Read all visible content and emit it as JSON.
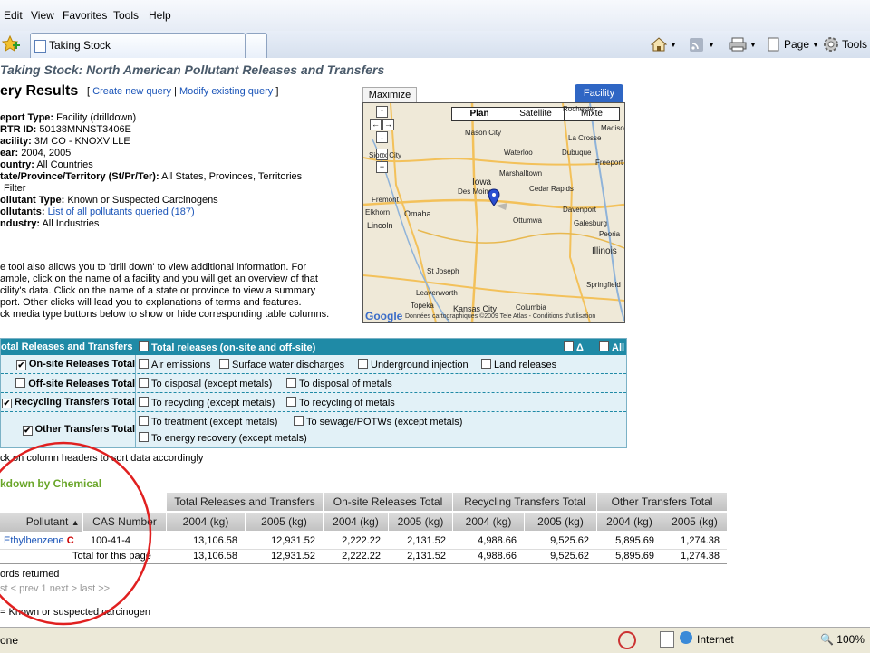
{
  "menu": [
    "Edit",
    "View",
    "Favorites",
    "Tools",
    "Help"
  ],
  "tab": {
    "label": "Taking Stock"
  },
  "toolbar": {
    "page": "Page",
    "tools": "Tools"
  },
  "page": {
    "title": "Taking Stock: North American Pollutant Releases and Transfers",
    "query_heading": "ery Results",
    "links": {
      "create": "Create new query",
      "modify": "Modify existing query"
    },
    "props": [
      {
        "label": "eport Type:",
        "value": "Facility (drilldown)"
      },
      {
        "label": "RTR ID:",
        "value": "50138MNNST3406E"
      },
      {
        "label": "acility:",
        "value": "3M CO - KNOXVILLE"
      },
      {
        "label": "ear:",
        "value": "2004, 2005"
      },
      {
        "label": "ountry:",
        "value": "All Countries"
      },
      {
        "label": "tate/Province/Territory (St/Pr/Ter):",
        "value": "All States, Provinces, Territories"
      },
      {
        "label": "",
        "value": "Filter"
      },
      {
        "label": "ollutant Type:",
        "value": "Known or Suspected Carcinogens"
      },
      {
        "label": "ollutants:",
        "value": "List of all pollutants queried (187)"
      },
      {
        "label": "ndustry:",
        "value": "All Industries"
      }
    ],
    "help_lines": [
      "e tool also allows you to 'drill down' to view additional information. For",
      "ample, click on the name of a facility and you will get an overview of that",
      "cility's data. Click on the name of a state or province to view a summary",
      "port. Other clicks will lead you to explanations of terms and features.",
      "ck media type buttons below to show or hide corresponding table columns."
    ]
  },
  "map": {
    "maximize": "Maximize",
    "tab": "Facility",
    "types": [
      "Plan",
      "Satellite",
      "Mixte"
    ],
    "cities": [
      "Rochester",
      "Madiso",
      "La Crosse",
      "Mason City",
      "Waterloo",
      "Dubuque",
      "Freeport",
      "Sioux City",
      "Iowa",
      "Marshalltown",
      "Cedar Rapids",
      "Des Moines",
      "Fremont",
      "Davenport",
      "Elkhorn",
      "Omaha",
      "Ottumwa",
      "Galesburg",
      "Lincoln",
      "Peoria",
      "Illinois",
      "St Joseph",
      "Springfield",
      "Leavenworth",
      "Topeka",
      "Kansas City",
      "Columbia"
    ],
    "copyright": "Données cartographiques ©2009 Tele Atlas - Conditions d'utilisation",
    "brand": "Google"
  },
  "filter": {
    "header_left": "otal Releases and Transfers",
    "header_total": "Total releases (on-site and off-site)",
    "header_delta": "Δ",
    "header_all": "All",
    "rows": [
      {
        "label": "On-site Releases Total",
        "checked": true,
        "items": [
          "Air emissions",
          "Surface water discharges",
          "Underground injection",
          "Land releases"
        ]
      },
      {
        "label": "Off-site Releases Total",
        "checked": false,
        "items": [
          "To disposal (except metals)",
          "To disposal of metals"
        ]
      },
      {
        "label": "Recycling Transfers Total",
        "checked": true,
        "items": [
          "To recycling (except metals)",
          "To recycling of metals"
        ]
      },
      {
        "label": "Other Transfers Total",
        "checked": true,
        "items": [
          "To treatment (except metals)",
          "To sewage/POTWs (except metals)",
          "To energy recovery (except metals)"
        ]
      }
    ]
  },
  "table": {
    "sort_hint": "ck on column headers to sort data accordingly",
    "section": "kdown by Chemical",
    "group_headers": [
      "Total Releases and Transfers",
      "On-site Releases Total",
      "Recycling Transfers Total",
      "Other Transfers Total"
    ],
    "col_pollutant": "Pollutant",
    "col_cas": "CAS Number",
    "col_years": [
      "2004 (kg)",
      "2005 (kg)",
      "2004 (kg)",
      "2005 (kg)",
      "2004 (kg)",
      "2005 (kg)",
      "2004 (kg)",
      "2005 (kg)"
    ],
    "row": {
      "pollutant": "Ethylbenzene",
      "flag": "C",
      "cas": "100-41-4",
      "values": [
        "13,106.58",
        "12,931.52",
        "2,222.22",
        "2,131.52",
        "4,988.66",
        "9,525.62",
        "5,895.69",
        "1,274.38"
      ]
    },
    "total": {
      "label": "Total for this page",
      "values": [
        "13,106.58",
        "12,931.52",
        "2,222.22",
        "2,131.52",
        "4,988.66",
        "9,525.62",
        "5,895.69",
        "1,274.38"
      ]
    },
    "records": "ords returned",
    "pager": "st < prev  1  next > last >>",
    "legend": "= Known or suspected carcinogen"
  },
  "status": {
    "left": "one",
    "zone": "Internet",
    "zoom": "100%"
  }
}
